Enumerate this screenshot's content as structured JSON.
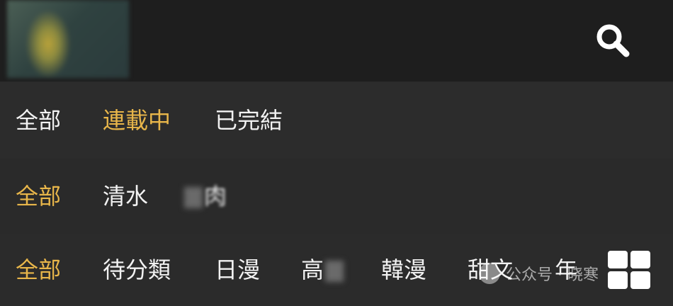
{
  "header": {
    "search_icon": "search-icon"
  },
  "filters": {
    "status": [
      "全部",
      "連載中",
      "已完結"
    ],
    "status_active_index": 1,
    "type": [
      "全部",
      "清水",
      "肉"
    ],
    "type_active_index": 0,
    "genre": [
      "全部",
      "待分類",
      "日漫",
      "高",
      "韓漫",
      "甜文",
      "年"
    ],
    "genre_active_index": 0
  },
  "watermark": {
    "text": "公众号 · 晓寒"
  },
  "colors": {
    "active": "#e8b64a",
    "text": "#f2f2f2",
    "background": "#2a2a2a",
    "header": "#1e1e1e"
  }
}
